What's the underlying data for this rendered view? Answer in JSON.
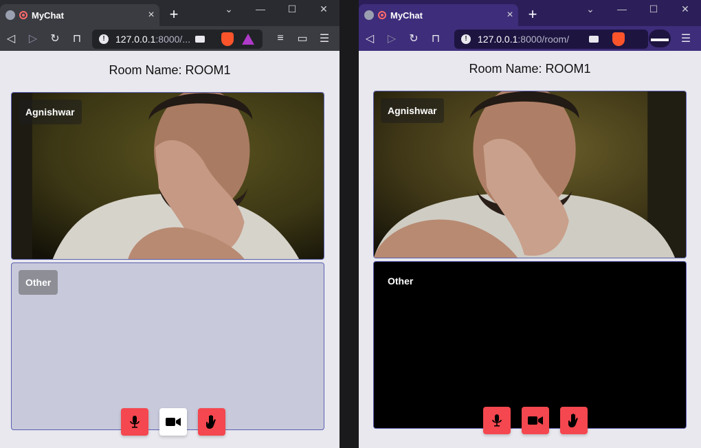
{
  "left_window": {
    "tab_title": "MyChat",
    "url_host": "127.0.0.1",
    "url_path": ":8000/...",
    "room_name": "Room Name: ROOM1",
    "self_name": "Agnishwar",
    "other_name": "Other",
    "video_button_active": true
  },
  "right_window": {
    "tab_title": "MyChat",
    "url_host": "127.0.0.1",
    "url_path": ":8000/room/",
    "room_name": "Room Name: ROOM1",
    "self_name": "Agnishwar",
    "other_name": "Other",
    "video_button_active": false
  },
  "icons": {
    "mic": "microphone-icon",
    "video": "video-camera-icon",
    "hand": "raise-hand-icon"
  },
  "colors": {
    "control_red": "#f4474f",
    "left_chrome": "#3b3c42",
    "right_chrome": "#3e2d7a",
    "page_bg": "#e8e8ee",
    "video_border": "#5a5fb0",
    "other_tile_left": "#c8cadb",
    "other_tile_right": "#000000"
  }
}
